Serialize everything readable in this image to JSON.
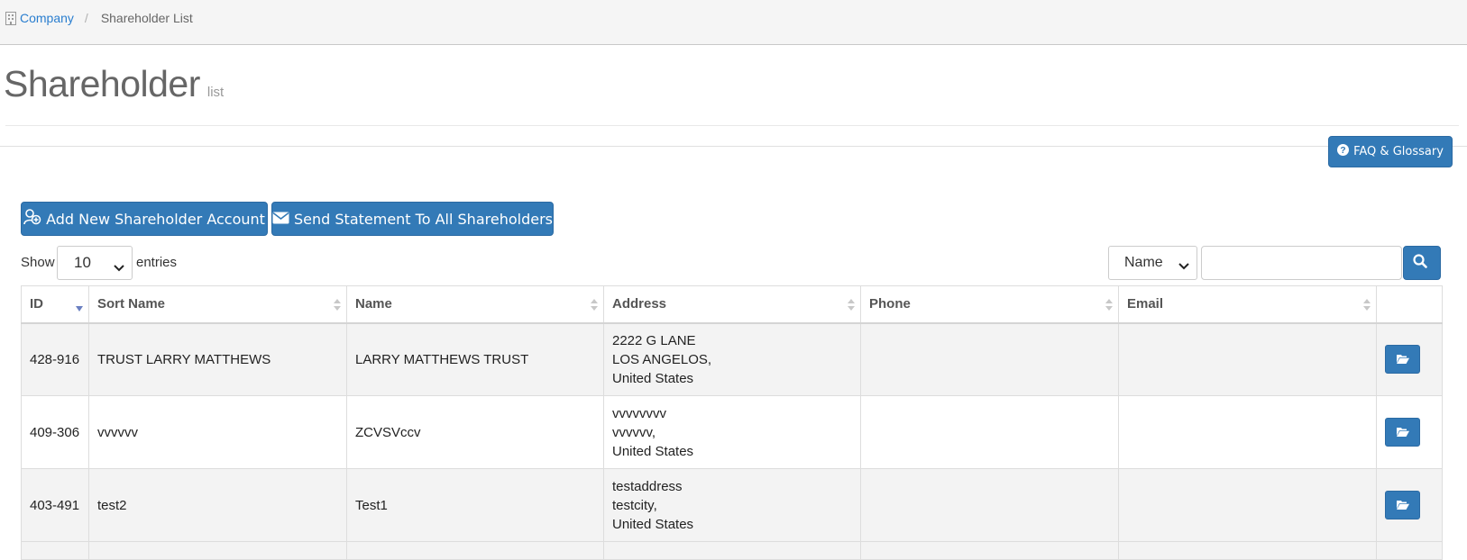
{
  "breadcrumb": {
    "link": "Company",
    "separator": "/",
    "current": "Shareholder List"
  },
  "page": {
    "title": "Shareholder",
    "subtitle": "list"
  },
  "buttons": {
    "faq": "FAQ & Glossary",
    "add": "Add New Shareholder Account",
    "send": "Send Statement To All Shareholders"
  },
  "length_menu": {
    "show_label": "Show",
    "value": "10",
    "entries_label": "entries"
  },
  "search": {
    "field": "Name",
    "query": ""
  },
  "table": {
    "headers": [
      "ID",
      "Sort Name",
      "Name",
      "Address",
      "Phone",
      "Email",
      ""
    ],
    "rows": [
      {
        "id": "428-916",
        "sort_name": "TRUST LARRY MATTHEWS",
        "name": "LARRY MATTHEWS TRUST",
        "address": [
          "2222 G LANE",
          "LOS ANGELOS,",
          "United States"
        ],
        "phone": "",
        "email": ""
      },
      {
        "id": "409-306",
        "sort_name": "vvvvvv",
        "name": "ZCVSVccv",
        "address": [
          "vvvvvvvv",
          "vvvvvv,",
          "United States"
        ],
        "phone": "",
        "email": ""
      },
      {
        "id": "403-491",
        "sort_name": "test2",
        "name": "Test1",
        "address": [
          "testaddress",
          "testcity,",
          "United States"
        ],
        "phone": "",
        "email": ""
      }
    ]
  },
  "icons": {
    "breadcrumb": "building-icon",
    "faq": "question-circle-icon",
    "add": "user-add-icon",
    "send": "envelope-icon",
    "search": "search-icon",
    "row_action": "folder-open-icon"
  },
  "colors": {
    "primary": "#337ab7",
    "link": "#2a7ecf",
    "sort_active": "#6a7fc1"
  }
}
